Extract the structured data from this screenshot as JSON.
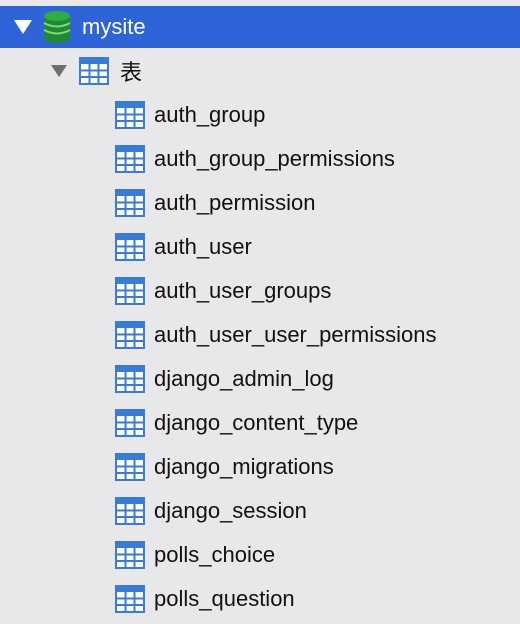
{
  "database": {
    "name": "mysite",
    "icon": "database-icon",
    "expanded": true,
    "selected": true,
    "color": "#2f64d9"
  },
  "group": {
    "label": "表",
    "icon": "table-icon",
    "expanded": true
  },
  "tables": [
    {
      "name": "auth_group"
    },
    {
      "name": "auth_group_permissions"
    },
    {
      "name": "auth_permission"
    },
    {
      "name": "auth_user"
    },
    {
      "name": "auth_user_groups"
    },
    {
      "name": "auth_user_user_permissions"
    },
    {
      "name": "django_admin_log"
    },
    {
      "name": "django_content_type"
    },
    {
      "name": "django_migrations"
    },
    {
      "name": "django_session"
    },
    {
      "name": "polls_choice"
    },
    {
      "name": "polls_question"
    }
  ]
}
